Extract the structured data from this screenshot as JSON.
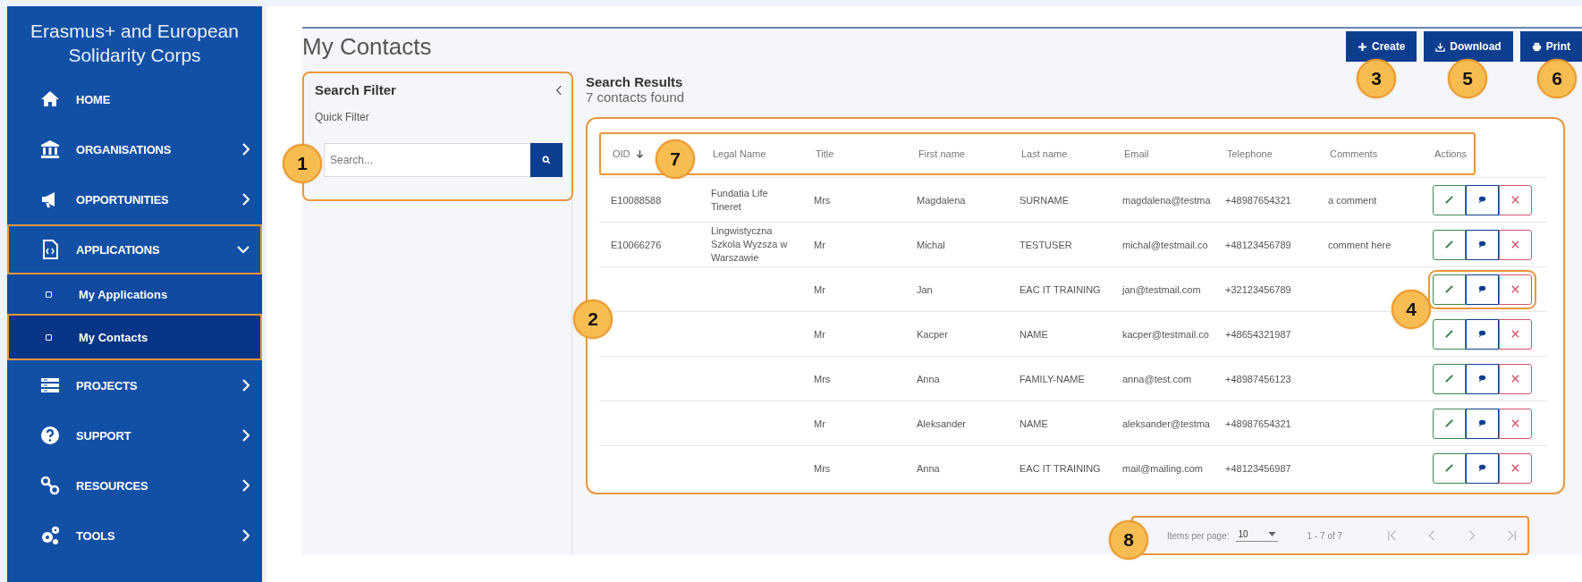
{
  "sidebar": {
    "title": "Erasmus+ and European Solidarity Corps",
    "items": [
      {
        "label": "HOME",
        "kind": "home"
      },
      {
        "label": "ORGANISATIONS",
        "kind": "bank",
        "expanded": false
      },
      {
        "label": "OPPORTUNITIES",
        "kind": "megaphone",
        "expanded": false
      },
      {
        "label": "APPLICATIONS",
        "kind": "document",
        "expanded": true,
        "outlined": true,
        "children": [
          {
            "label": "My Applications",
            "selected": false
          },
          {
            "label": "My Contacts",
            "selected": true,
            "outlined": true
          }
        ]
      },
      {
        "label": "PROJECTS",
        "kind": "list",
        "expanded": false
      },
      {
        "label": "SUPPORT",
        "kind": "question",
        "expanded": false
      },
      {
        "label": "RESOURCES",
        "kind": "links",
        "expanded": false
      },
      {
        "label": "TOOLS",
        "kind": "gears",
        "expanded": false
      }
    ]
  },
  "page_title": "My Contacts",
  "toolbar": [
    {
      "label": "Create",
      "kind": "plus"
    },
    {
      "label": "Download",
      "kind": "download"
    },
    {
      "label": "Print",
      "kind": "print"
    }
  ],
  "filter": {
    "title": "Search Filter",
    "quick_filter": "Quick Filter",
    "search": {
      "placeholder": "Search..."
    }
  },
  "results": {
    "title": "Search Results",
    "count": "7 contacts found"
  },
  "table": {
    "columns": [
      {
        "label": "OID",
        "sorted": true
      },
      {
        "label": "Legal Name"
      },
      {
        "label": "Title"
      },
      {
        "label": "First name"
      },
      {
        "label": "Last name"
      },
      {
        "label": "Email"
      },
      {
        "label": "Telephone"
      },
      {
        "label": "Comments"
      },
      {
        "label": "Actions"
      }
    ],
    "rows": [
      {
        "oid": "E10088588",
        "legal_name": "Fundatia Life Tineret",
        "title": "Mrs",
        "first_name": "Magdalena",
        "last_name": "SURNAME",
        "email": "magdalena@testma",
        "telephone": "+48987654321",
        "comments": "a comment"
      },
      {
        "oid": "E10066276",
        "legal_name": "Lingwistyczna Szkola Wyzsza w Warszawie",
        "title": "Mr",
        "first_name": "Michal",
        "last_name": "TESTUSER",
        "email": "michal@testmail.co",
        "telephone": "+48123456789",
        "comments": "comment here"
      },
      {
        "title": "Mr",
        "first_name": "Jan",
        "last_name": "EAC IT TRAINING",
        "email": "jan@testmail.com",
        "telephone": "+32123456789",
        "outlined": true
      },
      {
        "title": "Mr",
        "first_name": "Kacper",
        "last_name": "NAME",
        "email": "kacper@testmail.co",
        "telephone": "+48654321987"
      },
      {
        "title": "Mrs",
        "first_name": "Anna",
        "last_name": "FAMILY-NAME",
        "email": "anna@test.com",
        "telephone": "+48987456123"
      },
      {
        "title": "Mr",
        "first_name": "Aleksander",
        "last_name": "NAME",
        "email": "aleksander@testma",
        "telephone": "+48987654321"
      },
      {
        "title": "Mrs",
        "first_name": "Anna",
        "last_name": "EAC IT TRAINING",
        "email": "mail@mailing.com",
        "telephone": "+48123456987"
      }
    ]
  },
  "pager": {
    "items_label": "Items per page:",
    "page_size": "10",
    "range": "1 - 7 of 7"
  },
  "callouts": [
    "1",
    "2",
    "3",
    "4",
    "5",
    "6",
    "7",
    "8"
  ]
}
